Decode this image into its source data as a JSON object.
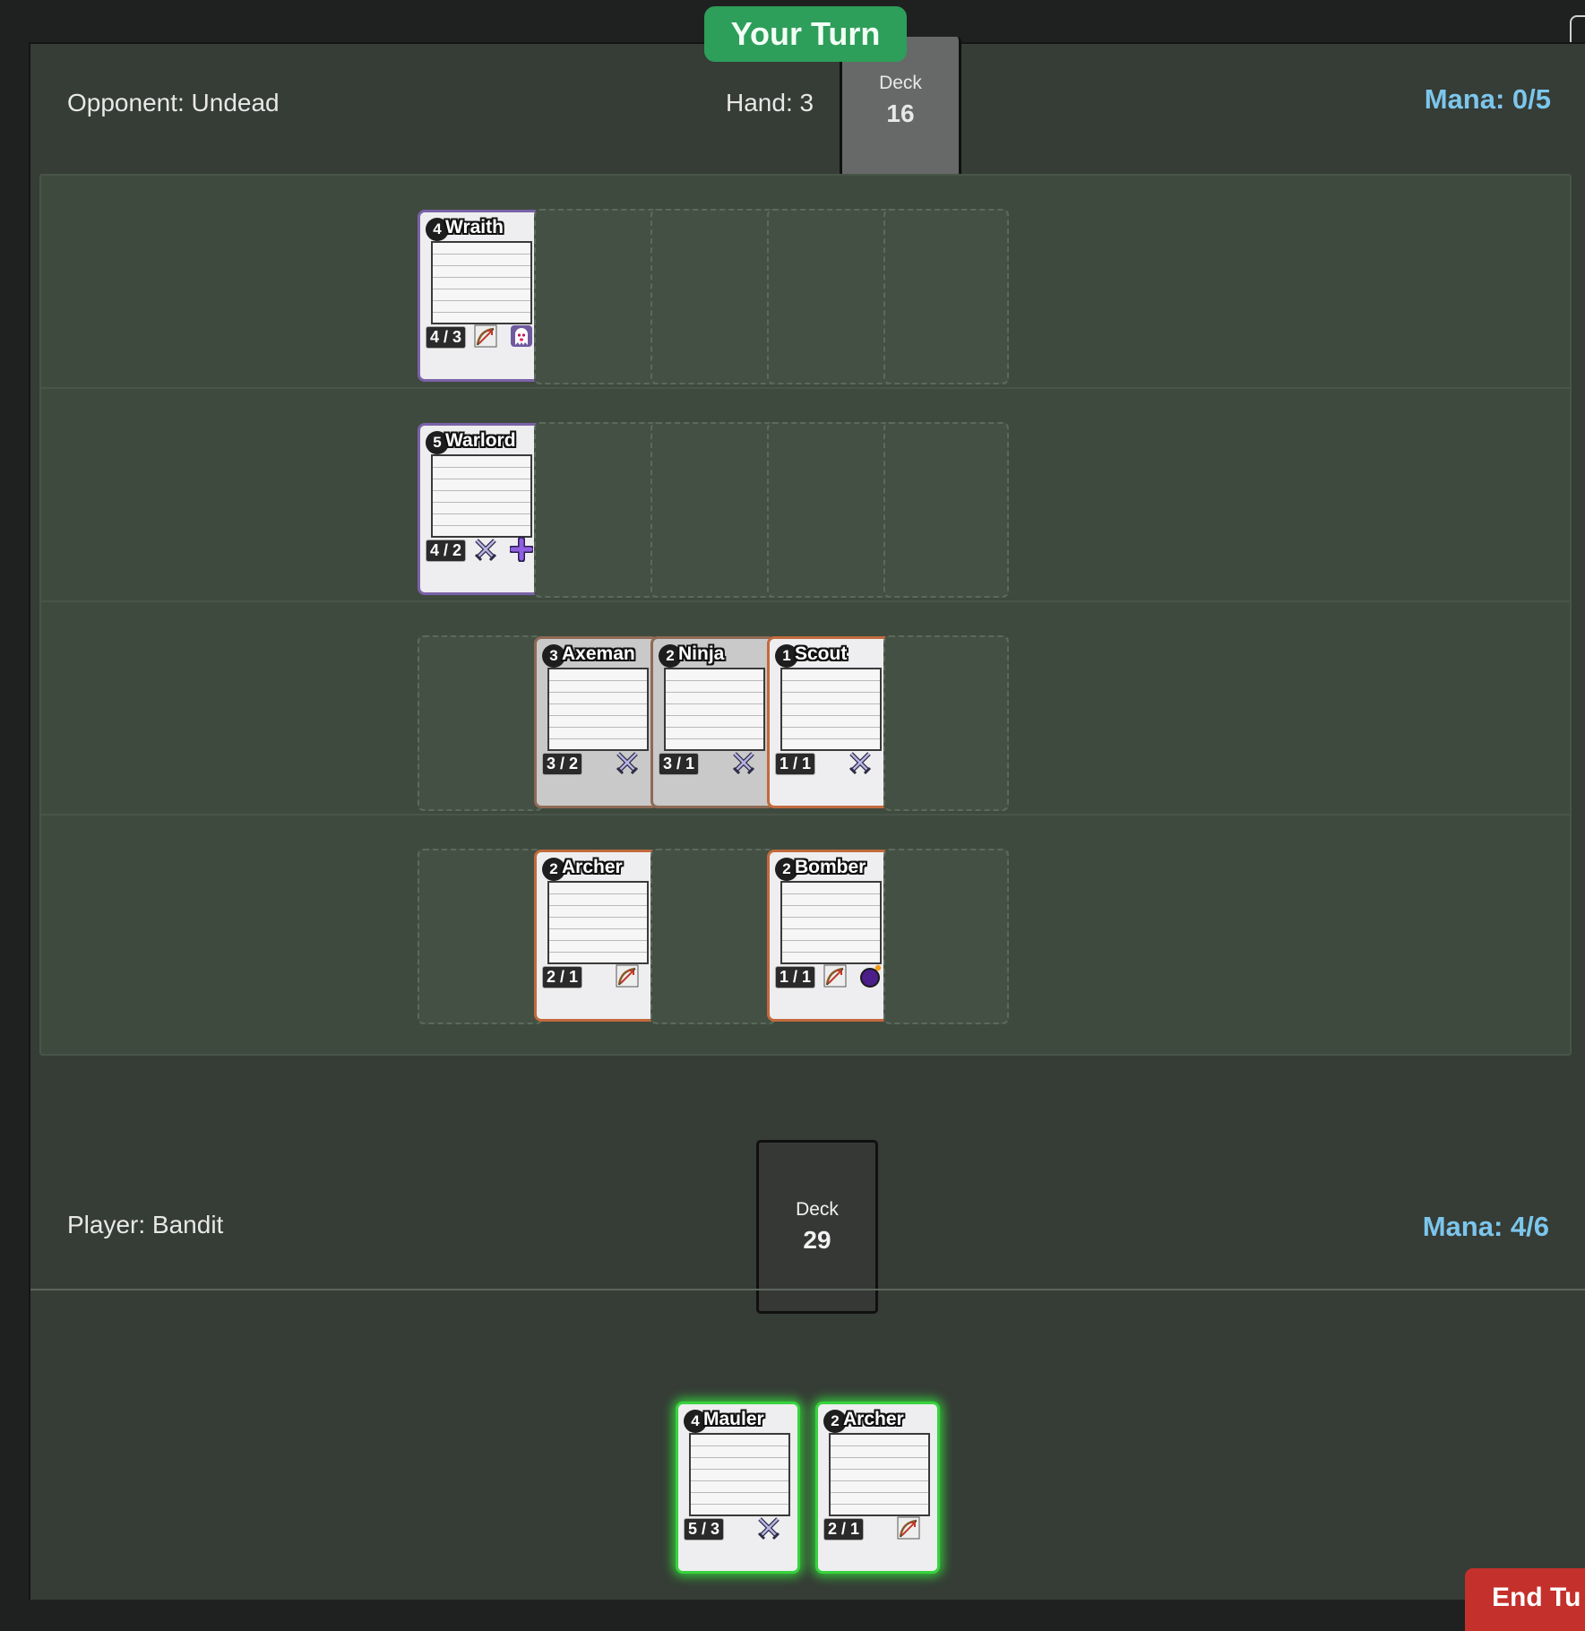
{
  "turn_banner": "Your Turn",
  "opponent": {
    "label": "Opponent: Undead",
    "hand": "Hand: 3",
    "mana": "Mana: 0/5",
    "deck_label": "Deck",
    "deck_count": "16"
  },
  "player": {
    "label": "Player: Bandit",
    "mana": "Mana: 4/6",
    "deck_label": "Deck",
    "deck_count": "29"
  },
  "end_turn": "End Tu",
  "lanes": [
    {
      "cards": [
        {
          "slot": 0,
          "cost": "4",
          "name": "Wraith",
          "stats": "4 / 3",
          "faction": "undead",
          "keywords": [
            "bow-icon",
            "ghost-icon"
          ]
        }
      ]
    },
    {
      "cards": [
        {
          "slot": 0,
          "cost": "5",
          "name": "Warlord",
          "stats": "4 / 2",
          "faction": "undead",
          "keywords": [
            "swords-icon",
            "plus-icon"
          ]
        }
      ]
    },
    {
      "cards": [
        {
          "slot": 1,
          "cost": "3",
          "name": "Axeman",
          "stats": "3 / 2",
          "faction": "bandit",
          "exhausted": true,
          "keywords": [
            "swords-icon"
          ]
        },
        {
          "slot": 2,
          "cost": "2",
          "name": "Ninja",
          "stats": "3 / 1",
          "faction": "bandit",
          "exhausted": true,
          "keywords": [
            "swords-icon"
          ]
        },
        {
          "slot": 3,
          "cost": "1",
          "name": "Scout",
          "stats": "1 / 1",
          "faction": "bandit",
          "keywords": [
            "swords-icon"
          ]
        }
      ]
    },
    {
      "cards": [
        {
          "slot": 1,
          "cost": "2",
          "name": "Archer",
          "stats": "2 / 1",
          "faction": "bandit",
          "keywords": [
            "bow-icon"
          ]
        },
        {
          "slot": 3,
          "cost": "2",
          "name": "Bomber",
          "stats": "1 / 1",
          "faction": "bandit",
          "keywords": [
            "bow-icon",
            "bomb-icon"
          ]
        }
      ]
    }
  ],
  "hand": [
    {
      "cost": "4",
      "name": "Mauler",
      "stats": "5 / 3",
      "keywords": [
        "swords-icon"
      ]
    },
    {
      "cost": "2",
      "name": "Archer",
      "stats": "2 / 1",
      "keywords": [
        "bow-icon"
      ]
    }
  ]
}
